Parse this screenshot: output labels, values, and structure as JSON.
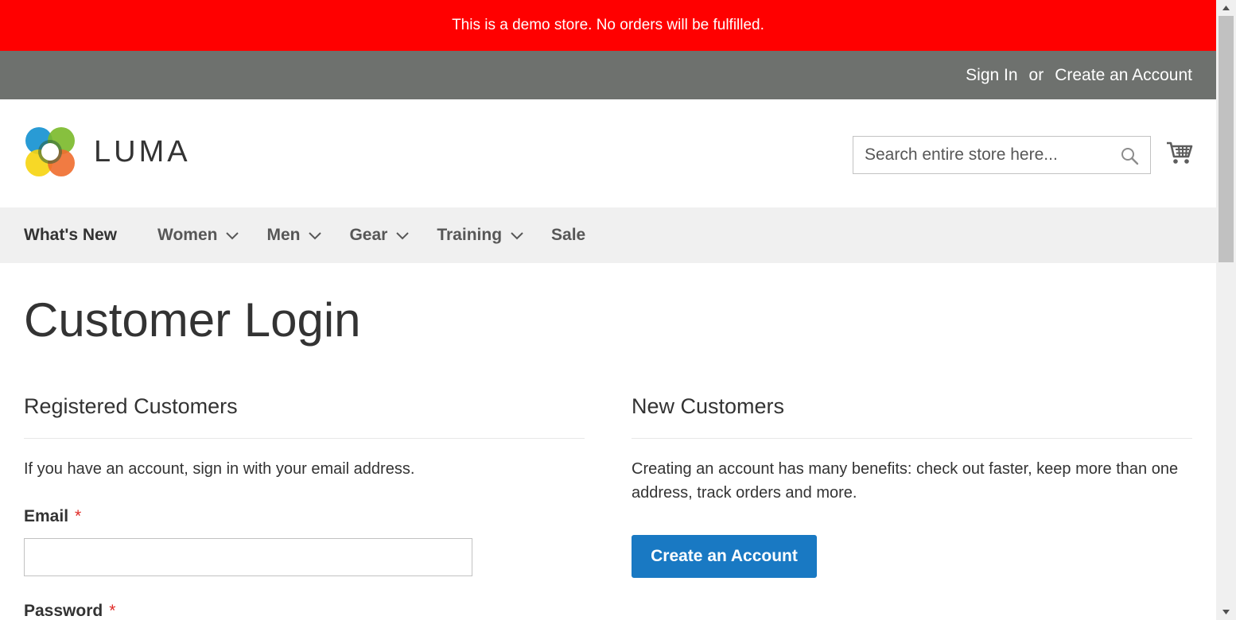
{
  "notice": {
    "text": "This is a demo store. No orders will be fulfilled."
  },
  "header": {
    "sign_in": "Sign In",
    "or": "or",
    "create_account": "Create an Account"
  },
  "logo": {
    "text": "LUMA"
  },
  "search": {
    "placeholder": "Search entire store here..."
  },
  "nav": {
    "items": [
      {
        "label": "What's New"
      },
      {
        "label": "Women"
      },
      {
        "label": "Men"
      },
      {
        "label": "Gear"
      },
      {
        "label": "Training"
      },
      {
        "label": "Sale"
      }
    ]
  },
  "page": {
    "title": "Customer Login"
  },
  "registered": {
    "title": "Registered Customers",
    "text": "If you have an account, sign in with your email address.",
    "email_label": "Email",
    "password_label": "Password",
    "required_mark": "*"
  },
  "new_customers": {
    "title": "New Customers",
    "text": "Creating an account has many benefits: check out faster, keep more than one address, track orders and more.",
    "button": "Create an Account"
  },
  "colors": {
    "notice_bg": "#ff0000",
    "header_bg": "#6e716e",
    "nav_bg": "#f0f0f0",
    "primary_button": "#1979c3",
    "required": "#e02b27"
  }
}
